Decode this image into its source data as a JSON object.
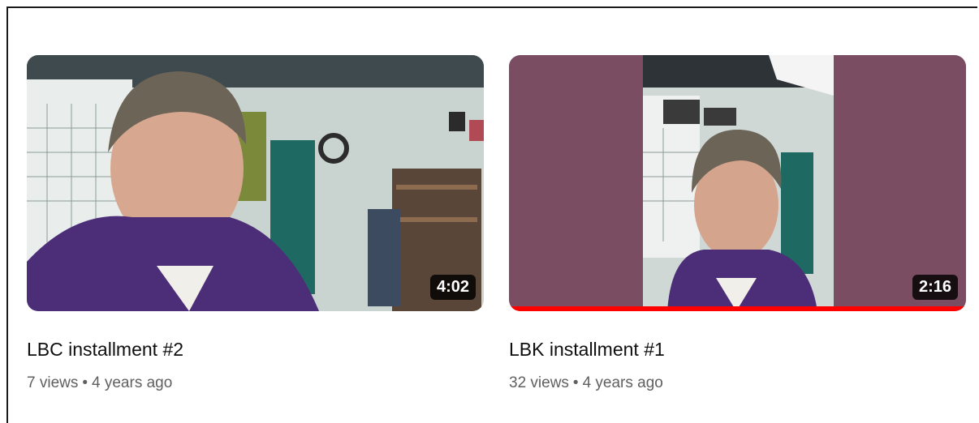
{
  "videos": [
    {
      "title": "LBC installment #2",
      "views": "7 views",
      "separator": "•",
      "age": "4 years ago",
      "duration": "4:02",
      "watched_fraction": 0
    },
    {
      "title": "LBK installment #1",
      "views": "32 views",
      "separator": "•",
      "age": "4 years ago",
      "duration": "2:16",
      "watched_fraction": 1.0
    }
  ],
  "colors": {
    "progress": "#ff0000",
    "pillarbox": "#7a4d62",
    "sweater": "#4b2d78"
  }
}
